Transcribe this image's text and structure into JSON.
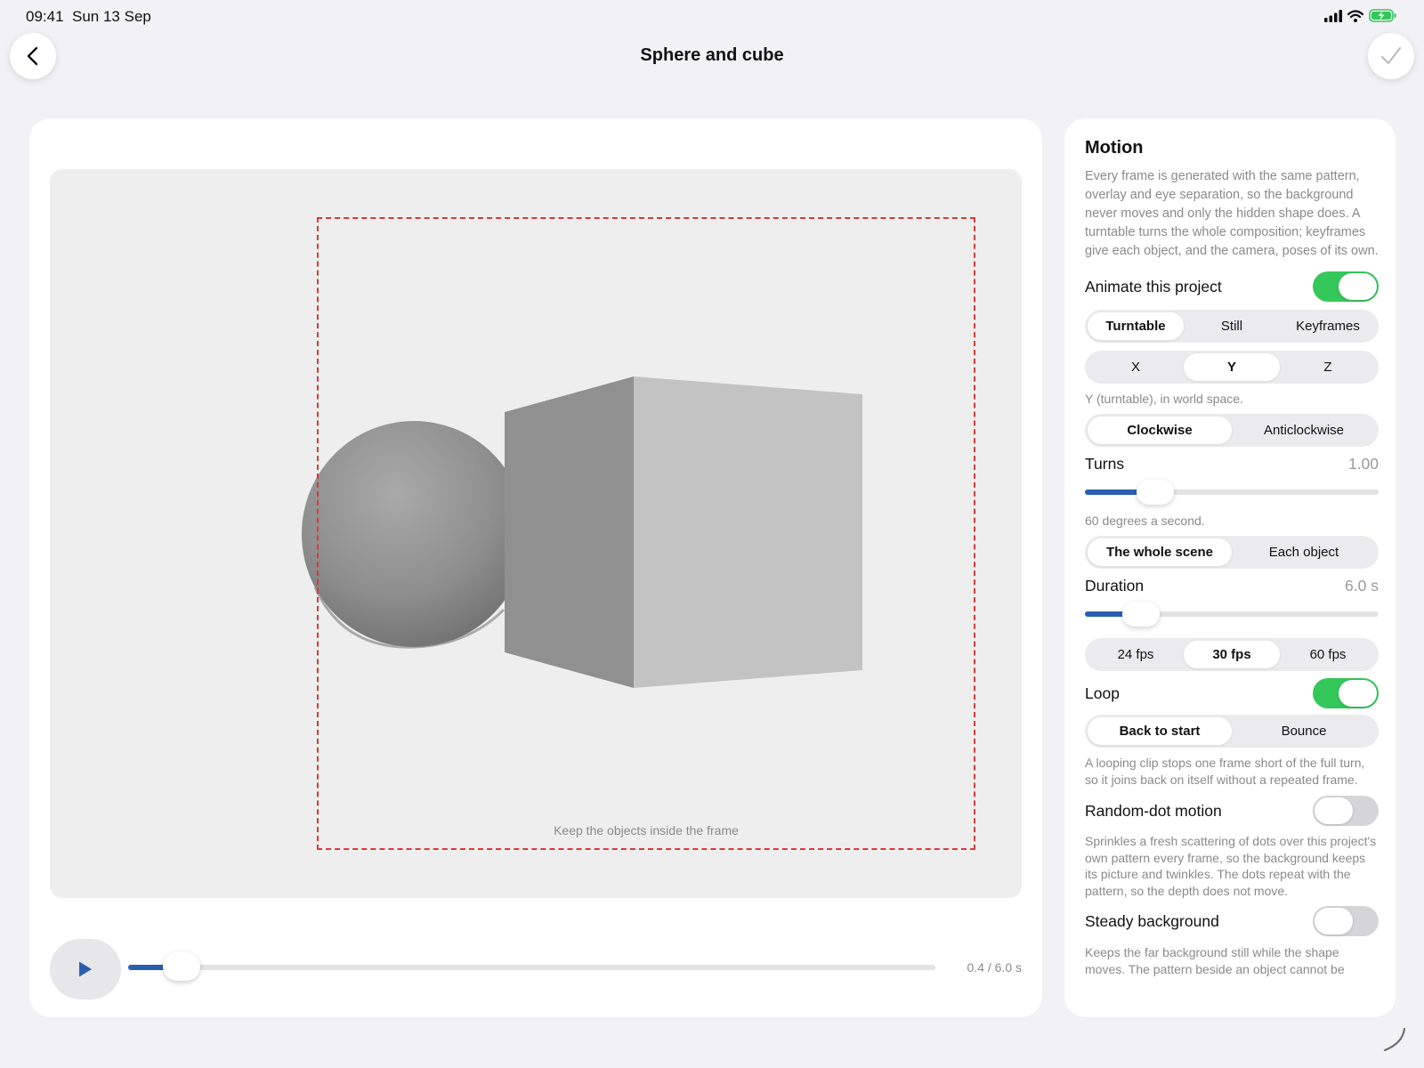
{
  "status_bar": {
    "time": "09:41",
    "date": "Sun 13 Sep"
  },
  "nav": {
    "title": "Sphere and cube",
    "back_icon": "chevron-left-icon",
    "done_icon": "checkmark-icon"
  },
  "canvas": {
    "frame_hint": "Keep the objects inside the frame",
    "playback": {
      "time_label": "0.4 / 6.0 s",
      "progress": 0.0667,
      "play_icon": "play-icon",
      "accent": "#2a5fb0"
    }
  },
  "motion": {
    "heading": "Motion",
    "description": "Every frame is generated with the same pattern, overlay and eye separation, so the background never moves and only the hidden shape does. A turntable turns the whole composition; keyframes give each object, and the camera, poses of its own.",
    "animate": {
      "label": "Animate this project",
      "on": true
    },
    "mode": {
      "options": [
        "Turntable",
        "Still",
        "Keyframes"
      ],
      "selected": 0
    },
    "axis": {
      "options": [
        "X",
        "Y",
        "Z"
      ],
      "selected": 1,
      "note": "Y (turntable), in world space."
    },
    "direction": {
      "options": [
        "Clockwise",
        "Anticlockwise"
      ],
      "selected": 0
    },
    "turns": {
      "label": "Turns",
      "value": "1.00",
      "fraction": 0.24,
      "note": "60 degrees a second."
    },
    "scope": {
      "options": [
        "The whole scene",
        "Each object"
      ],
      "selected": 0
    },
    "duration": {
      "label": "Duration",
      "value": "6.0 s",
      "fraction": 0.19
    },
    "fps": {
      "options": [
        "24 fps",
        "30 fps",
        "60 fps"
      ],
      "selected": 1
    },
    "loop": {
      "label": "Loop",
      "on": true
    },
    "loop_mode": {
      "options": [
        "Back to start",
        "Bounce"
      ],
      "selected": 0,
      "note": "A looping clip stops one frame short of the full turn, so it joins back on itself without a repeated frame."
    },
    "random_dot": {
      "label": "Random-dot motion",
      "on": false,
      "note": "Sprinkles a fresh scattering of dots over this project's own pattern every frame, so the background keeps its picture and twinkles. The dots repeat with the pattern, so the depth does not move."
    },
    "steady": {
      "label": "Steady background",
      "on": false,
      "note": "Keeps the far background still while the shape moves. The pattern beside an object cannot be"
    }
  },
  "colors": {
    "toggle_on": "#34c759",
    "frame_border": "#d63a3a",
    "slider_fill": "#2a5fb0"
  }
}
